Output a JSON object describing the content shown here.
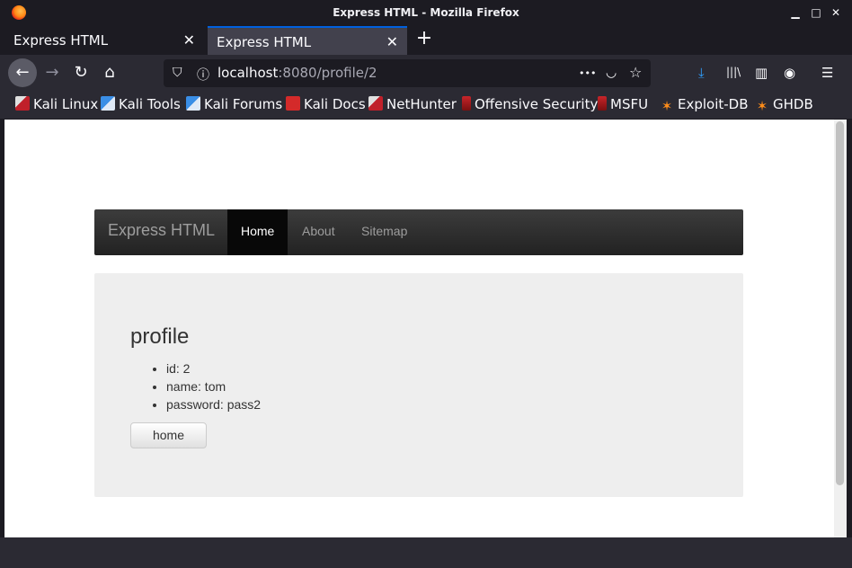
{
  "window": {
    "title": "Express HTML - Mozilla Firefox",
    "minimize_glyph": "▁",
    "maximize_glyph": "□",
    "close_glyph": "✕"
  },
  "tabs": [
    {
      "label": "Express HTML",
      "active": false,
      "close_glyph": "✕"
    },
    {
      "label": "Express HTML",
      "active": true,
      "close_glyph": "✕"
    }
  ],
  "new_tab_glyph": "+",
  "toolbar": {
    "back_icon": "arrow-left-icon",
    "back_glyph": "←",
    "forward_glyph": "→",
    "reload_glyph": "↻",
    "home_glyph": "⌂",
    "shield_glyph": "⛉",
    "info_glyph": "ⓘ",
    "url_host": "localhost",
    "url_rest": ":8080/profile/2",
    "more_glyph": "•••",
    "pocket_glyph": "◡",
    "star_glyph": "☆",
    "download_glyph": "⤓",
    "library_glyph": "|||\\",
    "sidebar_glyph": "▥",
    "account_glyph": "◉",
    "menu_glyph": "☰"
  },
  "bookmarks": [
    {
      "label": "Kali Linux",
      "icon": "kali-icon"
    },
    {
      "label": "Kali Tools",
      "icon": "kali-tools-icon"
    },
    {
      "label": "Kali Forums",
      "icon": "kali-forums-icon"
    },
    {
      "label": "Kali Docs",
      "icon": "kali-docs-icon"
    },
    {
      "label": "NetHunter",
      "icon": "nethunter-icon"
    },
    {
      "label": "Offensive Security",
      "icon": "offsec-icon"
    },
    {
      "label": "MSFU",
      "icon": "msfu-icon"
    },
    {
      "label": "Exploit-DB",
      "icon": "exploit-db-icon"
    },
    {
      "label": "GHDB",
      "icon": "ghdb-icon"
    }
  ],
  "site": {
    "brand": "Express HTML",
    "nav": [
      {
        "label": "Home",
        "active": true
      },
      {
        "label": "About",
        "active": false
      },
      {
        "label": "Sitemap",
        "active": false
      }
    ],
    "heading": "profile",
    "fields": [
      "id: 2",
      "name: tom",
      "password: pass2"
    ],
    "button_label": "home"
  },
  "colors": {
    "accent": "#0060df",
    "navbar_active": "#080808",
    "jumbotron": "#eeeeee"
  }
}
